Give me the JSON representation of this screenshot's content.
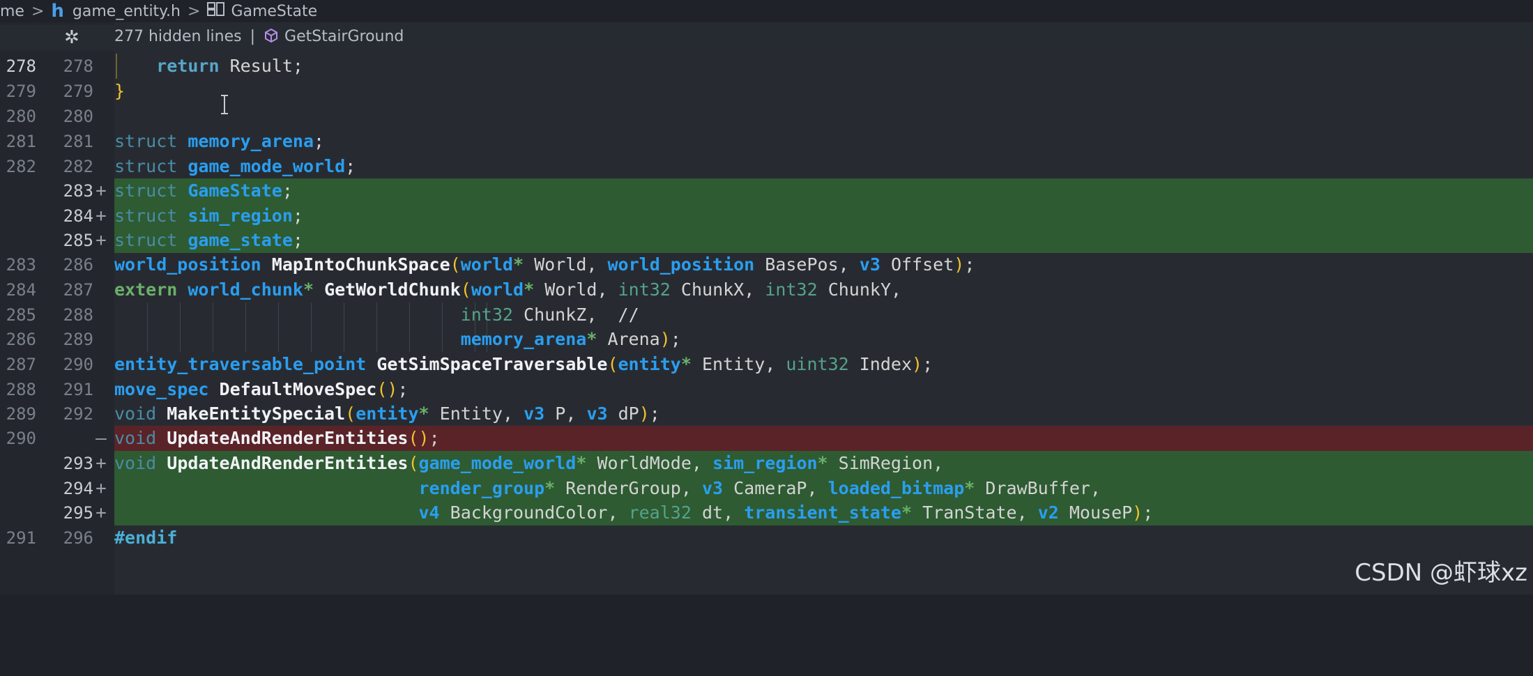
{
  "breadcrumb": {
    "segments": [
      "me",
      "game_entity.h",
      "GameState"
    ]
  },
  "sticky": {
    "hidden_lines": "277 hidden lines",
    "separator": "|",
    "symbol": "GetStairGround"
  },
  "lines": [
    {
      "old": "278",
      "new": "278",
      "mark": "",
      "code": "    return Result;"
    },
    {
      "old": "279",
      "new": "279",
      "mark": "",
      "code": "}"
    },
    {
      "old": "280",
      "new": "280",
      "mark": "",
      "code": ""
    },
    {
      "old": "281",
      "new": "281",
      "mark": "",
      "code": "struct memory_arena;"
    },
    {
      "old": "282",
      "new": "282",
      "mark": "",
      "code": "struct game_mode_world;"
    },
    {
      "old": "",
      "new": "283",
      "mark": "+",
      "code": "struct GameState;"
    },
    {
      "old": "",
      "new": "284",
      "mark": "+",
      "code": "struct sim_region;"
    },
    {
      "old": "",
      "new": "285",
      "mark": "+",
      "code": "struct game_state;"
    },
    {
      "old": "283",
      "new": "286",
      "mark": "",
      "code": "world_position MapIntoChunkSpace(world* World, world_position BasePos, v3 Offset);"
    },
    {
      "old": "284",
      "new": "287",
      "mark": "",
      "code": "extern world_chunk* GetWorldChunk(world* World, int32 ChunkX, int32 ChunkY,"
    },
    {
      "old": "285",
      "new": "288",
      "mark": "",
      "code": "                                 int32 ChunkZ,  //"
    },
    {
      "old": "286",
      "new": "289",
      "mark": "",
      "code": "                                 memory_arena* Arena);"
    },
    {
      "old": "287",
      "new": "290",
      "mark": "",
      "code": "entity_traversable_point GetSimSpaceTraversable(entity* Entity, uint32 Index);"
    },
    {
      "old": "288",
      "new": "291",
      "mark": "",
      "code": "move_spec DefaultMoveSpec();"
    },
    {
      "old": "289",
      "new": "292",
      "mark": "",
      "code": "void MakeEntitySpecial(entity* Entity, v3 P, v3 dP);"
    },
    {
      "old": "290",
      "new": "",
      "mark": "—",
      "code": "void UpdateAndRenderEntities();"
    },
    {
      "old": "",
      "new": "293",
      "mark": "+",
      "code": "void UpdateAndRenderEntities(game_mode_world* WorldMode, sim_region* SimRegion,"
    },
    {
      "old": "",
      "new": "294",
      "mark": "+",
      "code": "                             render_group* RenderGroup, v3 CameraP, loaded_bitmap* DrawBuffer,"
    },
    {
      "old": "",
      "new": "295",
      "mark": "+",
      "code": "                             v4 BackgroundColor, real32 dt, transient_state* TranState, v2 MouseP);"
    },
    {
      "old": "291",
      "new": "296",
      "mark": "",
      "code": "#endif"
    }
  ],
  "watermark": "CSDN @虾球xz",
  "colors": {
    "added": "#2e5b32",
    "removed": "#5a2328",
    "keyword": "#4a8ca6",
    "type": "#2a9ef0",
    "paren": "#f2c230"
  }
}
